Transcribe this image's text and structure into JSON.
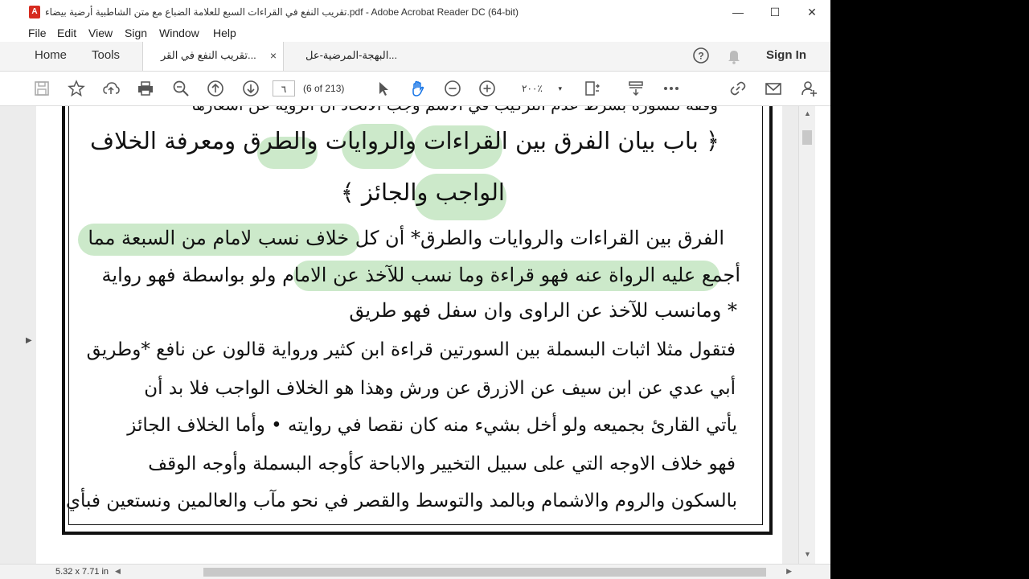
{
  "window": {
    "title": "تقريب النفع في القراءات السبع للعلامة الضباع مع متن الشاطبية  أرضية بيضاء.pdf - Adobe Acrobat Reader DC (64-bit)",
    "icon_letter": "A",
    "minimize": "—",
    "maximize": "☐",
    "close": "✕"
  },
  "menu": [
    "File",
    "Edit",
    "View",
    "Sign",
    "Window",
    "Help"
  ],
  "tabs": {
    "home": "Home",
    "tools": "Tools",
    "documents": [
      {
        "label": "تقريب النفع في القر...",
        "close": "×"
      },
      {
        "label": "البهجة-المرضية-عل..."
      }
    ],
    "sign_in": "Sign In"
  },
  "toolbar": {
    "page_number": "٦",
    "page_count": "(6 of 213)",
    "zoom": "٢٠٠٪",
    "zoom_caret": "▾"
  },
  "document": {
    "top_fragment": "وقفه للسورة بشرط عدم التركيب في الاسم وجب الاتحاد ان الروية عن اشعارها",
    "heading_line1": "﴿ باب بيان الفرق بين القراءات والروايات والطرق ومعرفة الخلاف",
    "heading_line2": "الواجب والجائز ﴾",
    "para1_line1": "الفرق بين القراءات والروايات والطرق* أن كل خلاف نسب لامام من السبعة مما",
    "para1_line2": "أجمع عليه الرواة عنه فهو قراءة وما نسب للآخذ عن الامام ولو بواسطة فهو رواية",
    "para1_line3": "* ومانسب للآخذ عن الراوى وان سفل فهو طريق",
    "para2_line1": "فتقول مثلا اثبات البسملة بين السورتين قراءة ابن كثير ورواية قالون عن نافع *وطريق",
    "para2_line2": "أبي عدي عن ابن سيف عن الازرق عن ورش وهذا هو الخلاف الواجب فلا بد أن",
    "para2_line3": "يأتي القارئ بجميعه ولو أخل بشيء منه كان نقصا في روايته  •  وأما الخلاف الجائز",
    "para2_line4": "فهو خلاف الاوجه التي على سبيل التخيير والاباحة كأوجه البسملة وأوجه الوقف",
    "para2_line5": "بالسكون والروم والاشمام وبالمد والتوسط والقصر في نحو مآب والعالمين ونستعين فبأي"
  },
  "status": {
    "page_size": "5.32 x 7.71 in"
  },
  "colors": {
    "highlight": "#b7e0b4",
    "acrobat_red": "#d62b1f"
  }
}
